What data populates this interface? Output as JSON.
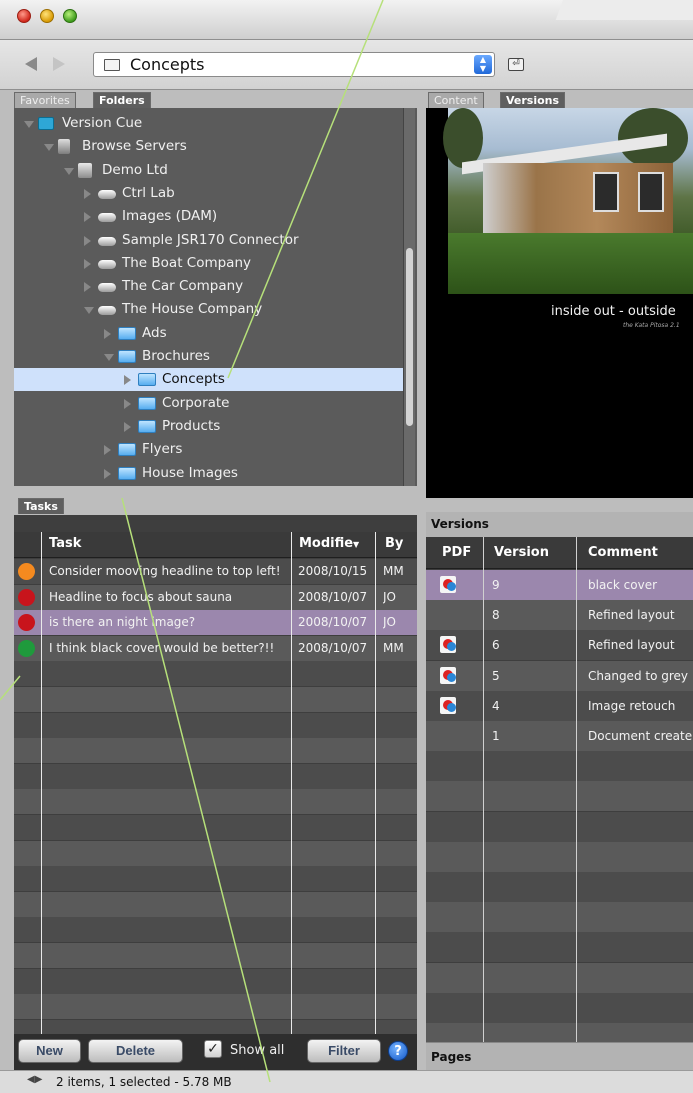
{
  "location": {
    "path": "Concepts"
  },
  "left_tabs": [
    "Favorites",
    "Folders"
  ],
  "right_tabs": [
    "Content",
    "Versions"
  ],
  "tree": [
    {
      "label": "Version Cue",
      "depth": 0,
      "icon": "version-cue-icon",
      "open": true
    },
    {
      "label": "Browse Servers",
      "depth": 1,
      "icon": "server-icon",
      "open": true
    },
    {
      "label": "Demo Ltd",
      "depth": 2,
      "icon": "organization-icon",
      "open": true
    },
    {
      "label": "Ctrl Lab",
      "depth": 3,
      "icon": "project-icon",
      "open": false
    },
    {
      "label": "Images (DAM)",
      "depth": 3,
      "icon": "project-icon",
      "open": false
    },
    {
      "label": "Sample JSR170 Connector",
      "depth": 3,
      "icon": "project-icon",
      "open": false
    },
    {
      "label": "The Boat Company",
      "depth": 3,
      "icon": "project-icon",
      "open": false
    },
    {
      "label": "The Car Company",
      "depth": 3,
      "icon": "project-icon",
      "open": false
    },
    {
      "label": "The House Company",
      "depth": 3,
      "icon": "project-icon",
      "open": true
    },
    {
      "label": "Ads",
      "depth": 4,
      "icon": "folder-icon",
      "open": false
    },
    {
      "label": "Brochures",
      "depth": 4,
      "icon": "folder-icon",
      "open": true
    },
    {
      "label": "Concepts",
      "depth": 5,
      "icon": "folder-icon",
      "open": false,
      "selected": true
    },
    {
      "label": "Corporate",
      "depth": 5,
      "icon": "folder-icon",
      "open": false
    },
    {
      "label": "Products",
      "depth": 5,
      "icon": "folder-icon",
      "open": false
    },
    {
      "label": "Flyers",
      "depth": 4,
      "icon": "folder-icon",
      "open": false
    },
    {
      "label": "House Images",
      "depth": 4,
      "icon": "folder-icon",
      "open": false
    }
  ],
  "tasks": {
    "tab": "Tasks",
    "columns": [
      "Task",
      "Modifie",
      "By"
    ],
    "rows": [
      {
        "status": "#f58a1f",
        "task": "Consider mooving headline to top left!",
        "modified": "2008/10/15",
        "by": "MM",
        "selected": false
      },
      {
        "status": "#c8141c",
        "task": "Headline to focus about sauna",
        "modified": "2008/10/07",
        "by": "JO",
        "selected": false
      },
      {
        "status": "#c8141c",
        "task": "is there an night image?",
        "modified": "2008/10/07",
        "by": "JO",
        "selected": true
      },
      {
        "status": "#1f9a3c",
        "task": "I think black cover would be better?!!",
        "modified": "2008/10/07",
        "by": "MM",
        "selected": false
      }
    ],
    "buttons": {
      "new": "New",
      "delete": "Delete",
      "filter": "Filter",
      "help": "?"
    },
    "show_all": {
      "label": "Show all",
      "checked": true
    }
  },
  "preview": {
    "slogan": "inside out - outside",
    "sub": "the Kata Pitosa 2.1"
  },
  "versions": {
    "title": "Versions",
    "columns": [
      "PDF",
      "Version",
      "Comment"
    ],
    "rows": [
      {
        "pdf": true,
        "version": "9",
        "comment": "black cover",
        "selected": true
      },
      {
        "pdf": false,
        "version": "8",
        "comment": "Refined layout",
        "selected": false
      },
      {
        "pdf": true,
        "version": "6",
        "comment": "Refined layout",
        "selected": false
      },
      {
        "pdf": true,
        "version": "5",
        "comment": "Changed to grey",
        "selected": false
      },
      {
        "pdf": true,
        "version": "4",
        "comment": "Image retouch",
        "selected": false
      },
      {
        "pdf": false,
        "version": "1",
        "comment": "Document create",
        "selected": false
      }
    ]
  },
  "pages_label": "Pages",
  "status": {
    "text": "2 items, 1 selected - 5.78 MB"
  },
  "colors": {
    "selection": "#cfe1fb",
    "row_selected": "#9b87ad",
    "callout": "#b6e07a"
  }
}
